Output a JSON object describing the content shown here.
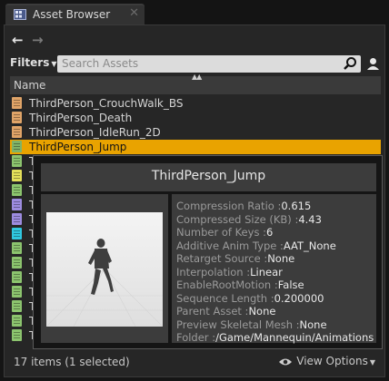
{
  "tab": {
    "title": "Asset Browser",
    "close": "✕",
    "icon": "asset-browser-icon"
  },
  "toolbar": {
    "back": "←",
    "forward": "→",
    "filters_label": "Filters",
    "filters_caret": "▼"
  },
  "search": {
    "placeholder": "Search Assets"
  },
  "list": {
    "header": "Name",
    "sort_indicator": "▲▲",
    "items": [
      {
        "label": "ThirdPerson_CrouchWalk_BS",
        "color": "#e0a468"
      },
      {
        "label": "ThirdPerson_Death",
        "color": "#e0a468"
      },
      {
        "label": "ThirdPerson_IdleRun_2D",
        "color": "#e0a468"
      },
      {
        "label": "ThirdPerson_Jump",
        "color": "#7fb368",
        "selected": true
      },
      {
        "label": "T",
        "color": "#8cc46e"
      },
      {
        "label": "T",
        "color": "#e4e05a"
      },
      {
        "label": "T",
        "color": "#8cc46e"
      },
      {
        "label": "T",
        "color": "#9d8ce0"
      },
      {
        "label": "T",
        "color": "#9d8ce0"
      },
      {
        "label": "T",
        "color": "#30c8e0"
      },
      {
        "label": "T",
        "color": "#8cc46e"
      },
      {
        "label": "T",
        "color": "#8cc46e"
      },
      {
        "label": "T",
        "color": "#8cc46e"
      },
      {
        "label": "T",
        "color": "#8cc46e"
      },
      {
        "label": "T",
        "color": "#8cc46e"
      },
      {
        "label": "T",
        "color": "#8cc46e"
      },
      {
        "label": "T",
        "color": "#8cc46e"
      }
    ]
  },
  "tooltip": {
    "title": "ThirdPerson_Jump",
    "properties": [
      {
        "key": "Compression Ratio :",
        "value": "0.615"
      },
      {
        "key": "Compressed Size (KB) :",
        "value": "4.43"
      },
      {
        "key": "Number of Keys :",
        "value": "6"
      },
      {
        "key": "Additive Anim Type :",
        "value": "AAT_None"
      },
      {
        "key": "Retarget Source :",
        "value": "None"
      },
      {
        "key": "Interpolation :",
        "value": "Linear"
      },
      {
        "key": "EnableRootMotion :",
        "value": "False"
      },
      {
        "key": "Sequence Length :",
        "value": "0.200000"
      },
      {
        "key": "Parent Asset :",
        "value": "None"
      },
      {
        "key": "Preview Skeletal Mesh :",
        "value": "None"
      },
      {
        "key": "Folder :",
        "value": "/Game/Mannequin/Animations"
      }
    ]
  },
  "footer": {
    "status": "17 items (1 selected)",
    "view_options": "View Options",
    "view_caret": "▼"
  },
  "colors": {
    "selection": "#e9a300",
    "background": "#262626"
  }
}
